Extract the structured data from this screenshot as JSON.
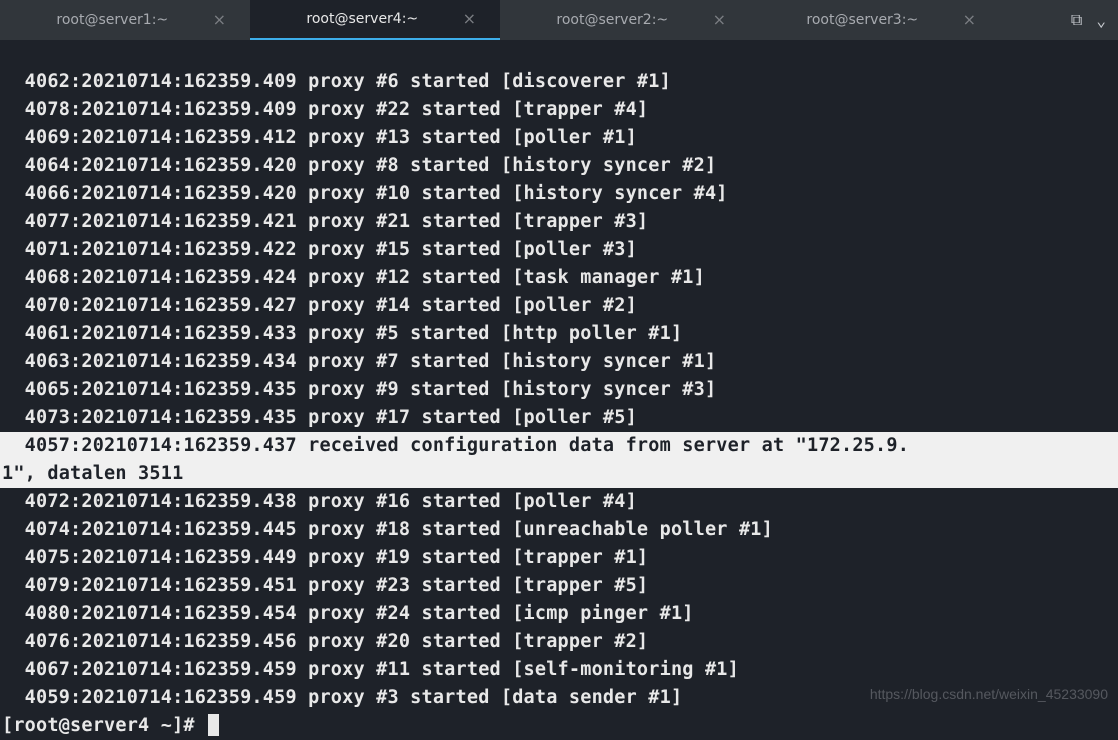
{
  "tabs": [
    {
      "title": "root@server1:~",
      "active": false
    },
    {
      "title": "root@server4:~",
      "active": true
    },
    {
      "title": "root@server2:~",
      "active": false
    },
    {
      "title": "root@server3:~",
      "active": false
    }
  ],
  "log_lines": [
    {
      "text": "  4062:20210714:162359.409 proxy #6 started [discoverer #1]",
      "highlighted": false
    },
    {
      "text": "  4078:20210714:162359.409 proxy #22 started [trapper #4]",
      "highlighted": false
    },
    {
      "text": "  4069:20210714:162359.412 proxy #13 started [poller #1]",
      "highlighted": false
    },
    {
      "text": "  4064:20210714:162359.420 proxy #8 started [history syncer #2]",
      "highlighted": false
    },
    {
      "text": "  4066:20210714:162359.420 proxy #10 started [history syncer #4]",
      "highlighted": false
    },
    {
      "text": "  4077:20210714:162359.421 proxy #21 started [trapper #3]",
      "highlighted": false
    },
    {
      "text": "  4071:20210714:162359.422 proxy #15 started [poller #3]",
      "highlighted": false
    },
    {
      "text": "  4068:20210714:162359.424 proxy #12 started [task manager #1]",
      "highlighted": false
    },
    {
      "text": "  4070:20210714:162359.427 proxy #14 started [poller #2]",
      "highlighted": false
    },
    {
      "text": "  4061:20210714:162359.433 proxy #5 started [http poller #1]",
      "highlighted": false
    },
    {
      "text": "  4063:20210714:162359.434 proxy #7 started [history syncer #1]",
      "highlighted": false
    },
    {
      "text": "  4065:20210714:162359.435 proxy #9 started [history syncer #3]",
      "highlighted": false
    },
    {
      "text": "  4073:20210714:162359.435 proxy #17 started [poller #5]",
      "highlighted": false
    },
    {
      "text": "  4057:20210714:162359.437 received configuration data from server at \"172.25.9.",
      "highlighted": true
    },
    {
      "text": "1\", datalen 3511",
      "highlighted": true
    },
    {
      "text": "  4072:20210714:162359.438 proxy #16 started [poller #4]",
      "highlighted": false
    },
    {
      "text": "  4074:20210714:162359.445 proxy #18 started [unreachable poller #1]",
      "highlighted": false
    },
    {
      "text": "  4075:20210714:162359.449 proxy #19 started [trapper #1]",
      "highlighted": false
    },
    {
      "text": "  4079:20210714:162359.451 proxy #23 started [trapper #5]",
      "highlighted": false
    },
    {
      "text": "  4080:20210714:162359.454 proxy #24 started [icmp pinger #1]",
      "highlighted": false
    },
    {
      "text": "  4076:20210714:162359.456 proxy #20 started [trapper #2]",
      "highlighted": false
    },
    {
      "text": "  4067:20210714:162359.459 proxy #11 started [self-monitoring #1]",
      "highlighted": false
    },
    {
      "text": "  4059:20210714:162359.459 proxy #3 started [data sender #1]",
      "highlighted": false
    }
  ],
  "prompt": "[root@server4 ~]# ",
  "watermark": "https://blog.csdn.net/weixin_45233090",
  "icons": {
    "close": "×",
    "split": "⧉",
    "menu": "⌄"
  }
}
